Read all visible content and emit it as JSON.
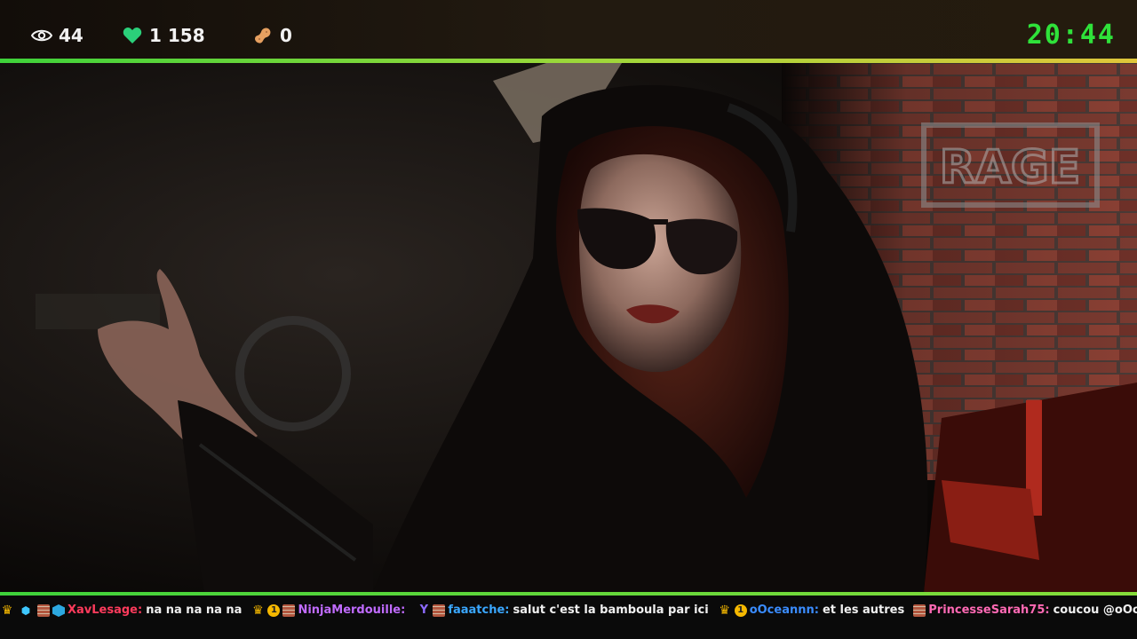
{
  "stats": {
    "viewers": "44",
    "followers": "1 158",
    "bits": "0",
    "clock": "20:44"
  },
  "colors": {
    "accent_green": "#3ed23a",
    "accent_yellow": "#e0c63a",
    "clock_green": "#2fe23a",
    "heart": "#2bd07a",
    "bits_icon": "#e6a060"
  },
  "icons": {
    "viewers": "eye-icon",
    "followers": "heart-icon",
    "bits": "peanut-icon"
  },
  "video": {
    "wall_sign": "RAGE"
  },
  "chat": [
    {
      "badges": [
        "crown-badge",
        "hex-badge",
        "brick-badge",
        "cube-badge"
      ],
      "user": "XavLesage:",
      "color": "#ff3b5c",
      "message": "na na na na na"
    },
    {
      "badges": [
        "crown-badge",
        "one-badge",
        "brick-badge"
      ],
      "user": "NinjaMerdouille:",
      "color": "#c06bff",
      "message": ""
    },
    {
      "badges": [
        "y-badge",
        "brick-badge"
      ],
      "user": "faaatche:",
      "color": "#3aa7ff",
      "message": "salut c'est la bamboula par ici"
    },
    {
      "badges": [
        "crown-badge",
        "one-badge"
      ],
      "user": "oOceannn:",
      "color": "#3a8cff",
      "message": "et les autres"
    },
    {
      "badges": [
        "brick-badge"
      ],
      "user": "PrincesseSarah75:",
      "color": "#ff69b4",
      "message": "coucou @oOceannn :)"
    }
  ]
}
